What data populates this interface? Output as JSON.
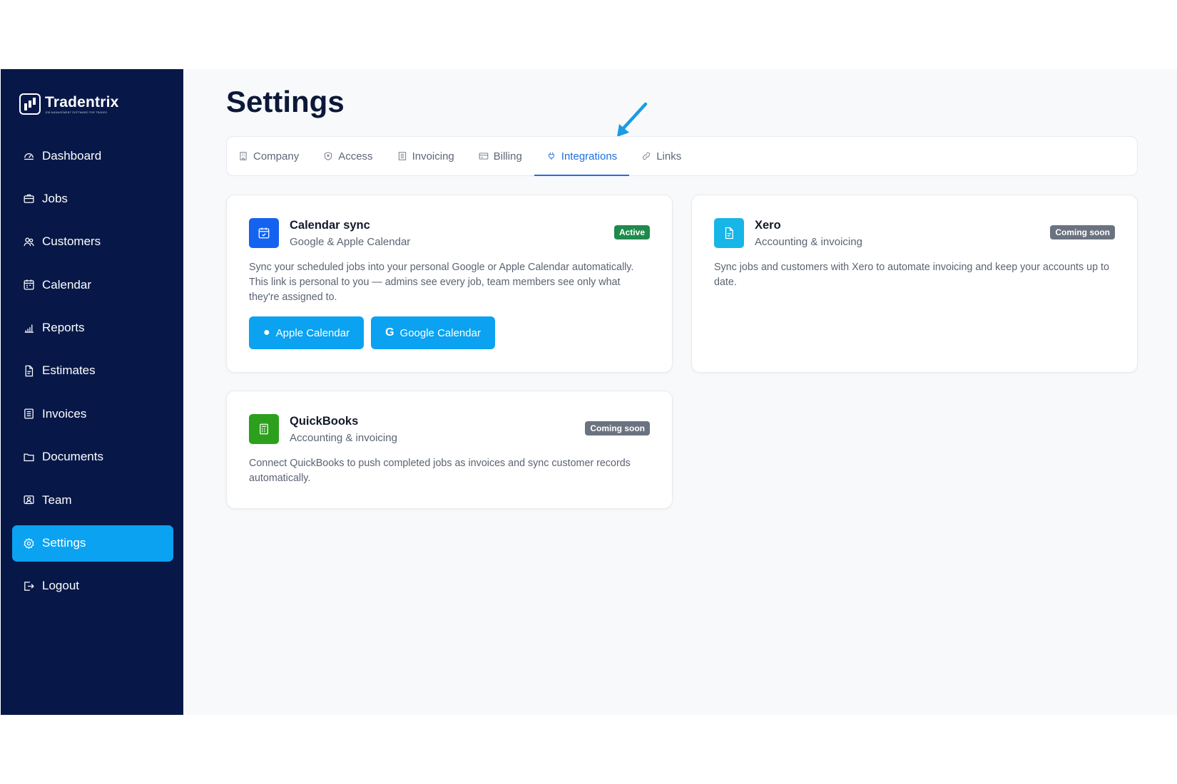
{
  "brand": {
    "name": "Tradentrix",
    "tagline": "Job management software for trades"
  },
  "sidebar": {
    "items": [
      {
        "label": "Dashboard",
        "icon": "dashboard-icon"
      },
      {
        "label": "Jobs",
        "icon": "briefcase-icon"
      },
      {
        "label": "Customers",
        "icon": "users-icon"
      },
      {
        "label": "Calendar",
        "icon": "calendar-icon"
      },
      {
        "label": "Reports",
        "icon": "bar-chart-icon"
      },
      {
        "label": "Estimates",
        "icon": "document-icon"
      },
      {
        "label": "Invoices",
        "icon": "receipt-icon"
      },
      {
        "label": "Documents",
        "icon": "folder-icon"
      },
      {
        "label": "Team",
        "icon": "team-icon"
      },
      {
        "label": "Settings",
        "icon": "gear-icon",
        "active": true
      },
      {
        "label": "Logout",
        "icon": "logout-icon"
      }
    ]
  },
  "page": {
    "title": "Settings"
  },
  "tabs": [
    {
      "label": "Company",
      "icon": "building-icon"
    },
    {
      "label": "Access",
      "icon": "shield-icon"
    },
    {
      "label": "Invoicing",
      "icon": "receipt-icon"
    },
    {
      "label": "Billing",
      "icon": "credit-card-icon"
    },
    {
      "label": "Integrations",
      "icon": "plug-icon",
      "active": true
    },
    {
      "label": "Links",
      "icon": "link-icon"
    }
  ],
  "cards": {
    "calendar": {
      "title": "Calendar sync",
      "subtitle": "Google & Apple Calendar",
      "badge": "Active",
      "description": "Sync your scheduled jobs into your personal Google or Apple Calendar automatically. This link is personal to you — admins see every job, team members see only what they're assigned to.",
      "buttons": {
        "apple": "Apple Calendar",
        "google": "Google Calendar"
      }
    },
    "xero": {
      "title": "Xero",
      "subtitle": "Accounting & invoicing",
      "badge": "Coming soon",
      "description": "Sync jobs and customers with Xero to automate invoicing and keep your accounts up to date."
    },
    "quickbooks": {
      "title": "QuickBooks",
      "subtitle": "Accounting & invoicing",
      "badge": "Coming soon",
      "description": "Connect QuickBooks to push completed jobs as invoices and sync customer records automatically."
    }
  },
  "colors": {
    "sidebar_bg": "#071848",
    "accent": "#0ba2f1",
    "tab_active": "#1d6fe0",
    "badge_active": "#1f8a4c",
    "badge_coming": "#6b7280",
    "calendar_icon": "#1463f0",
    "xero_icon": "#17b5e8",
    "quickbooks_icon": "#2ca01c"
  }
}
